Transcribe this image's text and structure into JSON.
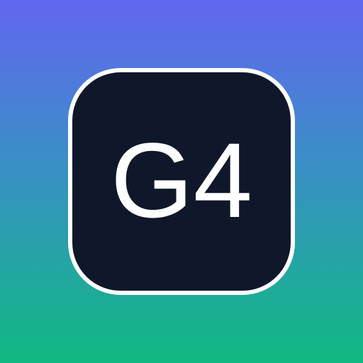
{
  "badge": {
    "text": "G4"
  },
  "colors": {
    "gradient_top": "#6366F1",
    "gradient_bottom": "#10B981",
    "tile_background": "#0F172A",
    "tile_border": "#FFFFFF",
    "text": "#FFFFFF"
  }
}
